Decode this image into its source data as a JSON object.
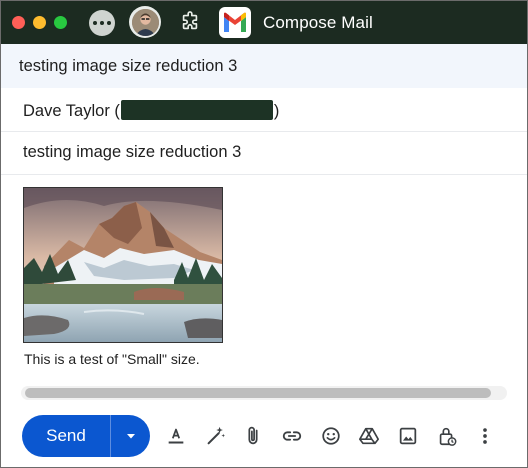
{
  "window": {
    "title": "Compose Mail",
    "traffic_lights": [
      "close",
      "minimize",
      "zoom"
    ]
  },
  "compose": {
    "header_subject": "testing image size reduction 3",
    "to": {
      "name_prefix": "Dave Taylor (",
      "name_suffix": ")"
    },
    "subject": "testing image size reduction 3",
    "body": {
      "image_icon": "mountain-watercolor-image",
      "text": "This is a test of \"Small\" size."
    }
  },
  "toolbar": {
    "send_label": "Send",
    "icons": [
      "text-format-icon",
      "magic-edit-icon",
      "attach-icon",
      "link-icon",
      "emoji-icon",
      "drive-icon",
      "insert-photo-icon",
      "confidential-mode-icon",
      "more-options-icon"
    ]
  },
  "colors": {
    "titlebar": "#1c2b21",
    "subject_bar": "#f2f6fc",
    "send_button": "#0b57d0",
    "redaction": "#1d3325"
  }
}
